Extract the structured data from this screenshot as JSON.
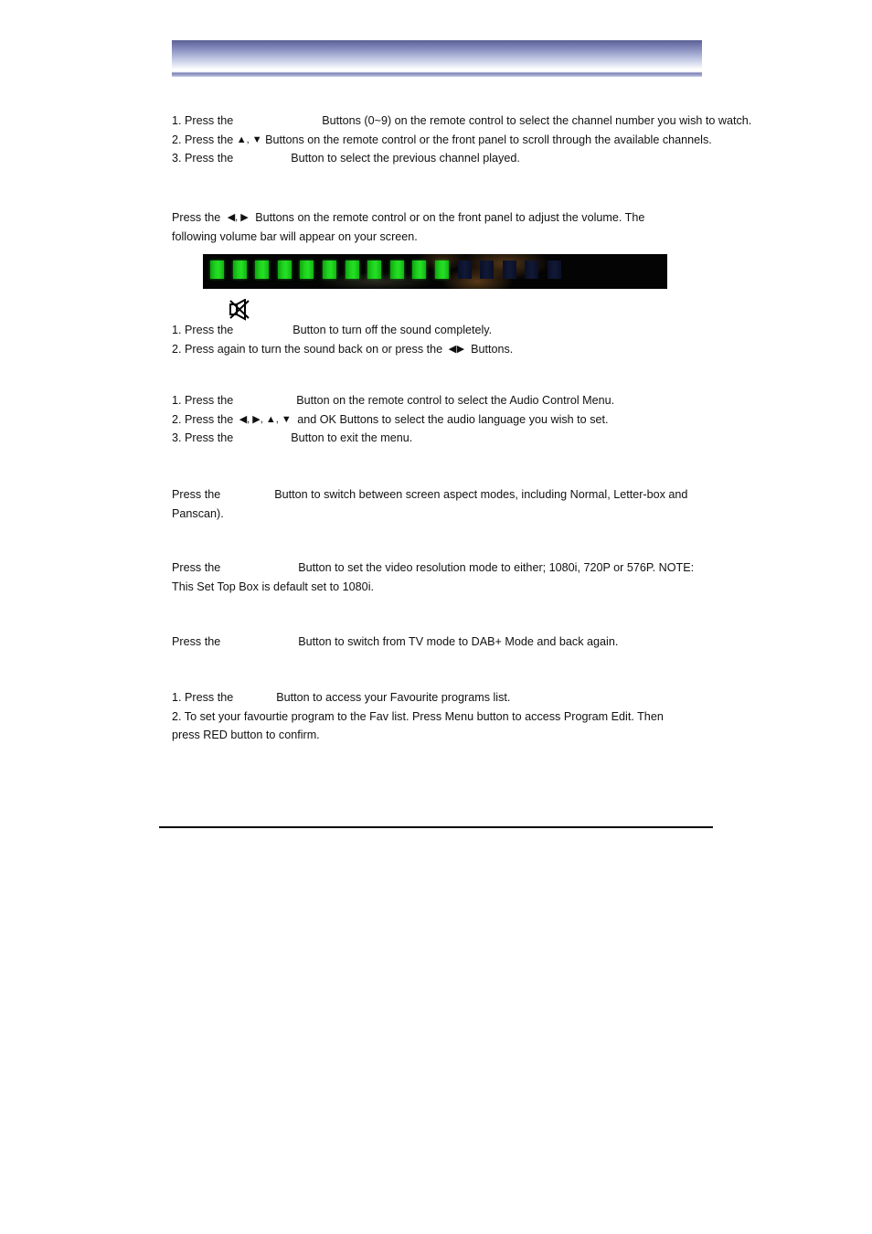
{
  "document": {
    "header_banner": {
      "name": "decorative-gradient-banner",
      "gradient_top_color": "#5b5f93",
      "gradient_mid_color": "#b9c0de",
      "gradient_bottom_color": "#ffffff"
    },
    "sections": [
      {
        "id": "channel-selection",
        "lines": [
          {
            "parts": [
              {
                "type": "text",
                "value": "1. Press the"
              },
              {
                "type": "missing-button-image",
                "value": ""
              },
              {
                "type": "text",
                "value": "Buttons (0~9) on the remote control to select the channel number you wish to watch."
              }
            ]
          },
          {
            "parts": [
              {
                "type": "text",
                "value": "2. Press the"
              },
              {
                "type": "glyph",
                "value": "▲, ▼"
              },
              {
                "type": "text",
                "value": "Buttons on the remote control or the front panel to scroll through the available channels."
              }
            ]
          },
          {
            "parts": [
              {
                "type": "text",
                "value": "3. Press the"
              },
              {
                "type": "missing-button-image",
                "value": ""
              },
              {
                "type": "text",
                "value": "Button to select the previous channel played."
              }
            ]
          }
        ]
      },
      {
        "id": "volume-control",
        "lines": [
          {
            "parts": [
              {
                "type": "text",
                "value": "Press the"
              },
              {
                "type": "glyph",
                "value": "◀, ▶"
              },
              {
                "type": "text",
                "value": "Buttons on the remote control or on the front panel to adjust the volume. The following volume bar will appear on your screen."
              }
            ]
          }
        ]
      },
      {
        "id": "mute-control",
        "lines": [
          {
            "parts": [
              {
                "type": "text",
                "value": "1. Press the"
              },
              {
                "type": "missing-button-image",
                "value": ""
              },
              {
                "type": "text",
                "value": "Button to turn off the sound completely."
              }
            ]
          },
          {
            "parts": [
              {
                "type": "text",
                "value": "2. Press again to turn the sound back on or press the"
              },
              {
                "type": "glyph",
                "value": "◀▶"
              },
              {
                "type": "text",
                "value": "Buttons."
              }
            ]
          }
        ]
      },
      {
        "id": "audio-control",
        "lines": [
          {
            "parts": [
              {
                "type": "text",
                "value": "1. Press the"
              },
              {
                "type": "missing-button-image",
                "value": ""
              },
              {
                "type": "text",
                "value": "Button on the remote control to select the Audio Control Menu."
              }
            ]
          },
          {
            "parts": [
              {
                "type": "text",
                "value": "2. Press the"
              },
              {
                "type": "glyph",
                "value": "◀, ▶, ▲, ▼"
              },
              {
                "type": "text",
                "value": "and OK Buttons to select the audio language you wish to set."
              }
            ]
          },
          {
            "parts": [
              {
                "type": "text",
                "value": "3. Press the"
              },
              {
                "type": "missing-button-image",
                "value": ""
              },
              {
                "type": "text",
                "value": "Button to exit the menu."
              }
            ]
          }
        ]
      },
      {
        "id": "aspect-ratio",
        "lines": [
          {
            "parts": [
              {
                "type": "text",
                "value": "Press the"
              },
              {
                "type": "missing-button-image",
                "value": ""
              },
              {
                "type": "text",
                "value": "Button to switch between screen aspect modes, including Normal, Letter-box and Panscan)."
              }
            ]
          }
        ]
      },
      {
        "id": "video-resolution",
        "lines": [
          {
            "parts": [
              {
                "type": "text",
                "value": "Press the"
              },
              {
                "type": "missing-button-image",
                "value": ""
              },
              {
                "type": "text",
                "value": "Button to set the video resolution mode to either; 1080i, 720P or 576P. NOTE: This Set Top Box is default set to 1080i."
              }
            ]
          }
        ]
      },
      {
        "id": "dab-mode",
        "lines": [
          {
            "parts": [
              {
                "type": "text",
                "value": "Press the"
              },
              {
                "type": "missing-button-image",
                "value": ""
              },
              {
                "type": "text",
                "value": "Button to switch from TV mode to DAB+ Mode and back again."
              }
            ]
          }
        ]
      },
      {
        "id": "favourites",
        "lines": [
          {
            "parts": [
              {
                "type": "text",
                "value": "1. Press the"
              },
              {
                "type": "missing-button-image",
                "value": ""
              },
              {
                "type": "text",
                "value": "Button to access your Favourite programs list."
              }
            ]
          },
          {
            "parts": [
              {
                "type": "text",
                "value": "2. To set your favourtie program to the Fav list. Press Menu button to access Program Edit.    Then press RED button to confirm."
              }
            ]
          }
        ]
      }
    ]
  },
  "text": {
    "s1_l1_a": "1. Press the",
    "s1_l1_b": "Buttons (0~9) on the remote control to select the channel number you wish to watch.",
    "s1_l2_a": "2. Press the",
    "s1_l2_arrows": "▲, ▼",
    "s1_l2_b": "Buttons on the remote control or the front panel to scroll through the available channels.",
    "s1_l3_a": "3. Press the",
    "s1_l3_b": "Button to select the previous channel played.",
    "s2_a": "Press the",
    "s2_arrows": "◀, ▶",
    "s2_b": "Buttons on the remote control or on the front panel to adjust the volume. The following volume bar will appear on your screen.",
    "s3_l1_a": "1. Press the",
    "s3_l1_b": "Button to turn off the sound completely.",
    "s3_l2_a": "2. Press again to turn the sound back on or press the",
    "s3_l2_arrows": "◀▶",
    "s3_l2_b": "Buttons.",
    "s4_l1_a": "1. Press the",
    "s4_l1_b": "Button on the remote control to select the Audio Control Menu.",
    "s4_l2_a": "2. Press the",
    "s4_l2_arrows": "◀, ▶, ▲, ▼",
    "s4_l2_b": "and OK Buttons to select the audio language you wish to set.",
    "s4_l3_a": "3. Press the",
    "s4_l3_b": "Button to exit the menu.",
    "s5_a": "Press the",
    "s5_b": "Button to switch between screen aspect modes, including Normal, Letter-box and",
    "s5_c": "Panscan).",
    "s6_a": "Press the",
    "s6_b": "Button to set the video resolution mode to either; 1080i, 720P or 576P. NOTE:",
    "s6_c": "This Set Top Box is default set to 1080i.",
    "s7_a": "Press the",
    "s7_b": "Button to switch from TV mode to DAB+ Mode and back again.",
    "s8_l1_a": "1. Press the",
    "s8_l1_b": "Button to access your Favourite programs list.",
    "s8_l2_a": "2. To set your favourtie program to the Fav list. Press Menu button to access Program Edit.    Then",
    "s8_l2_b": "press RED button to confirm."
  },
  "volume_bar": {
    "name": "on-screen-volume-bar",
    "total_segments": 16,
    "filled_segments": 11,
    "filled_color": "#1fd11f",
    "empty_color": "#111936",
    "background_color": "#040404"
  },
  "icons": {
    "mute": "mute-speaker-crossed-icon"
  }
}
